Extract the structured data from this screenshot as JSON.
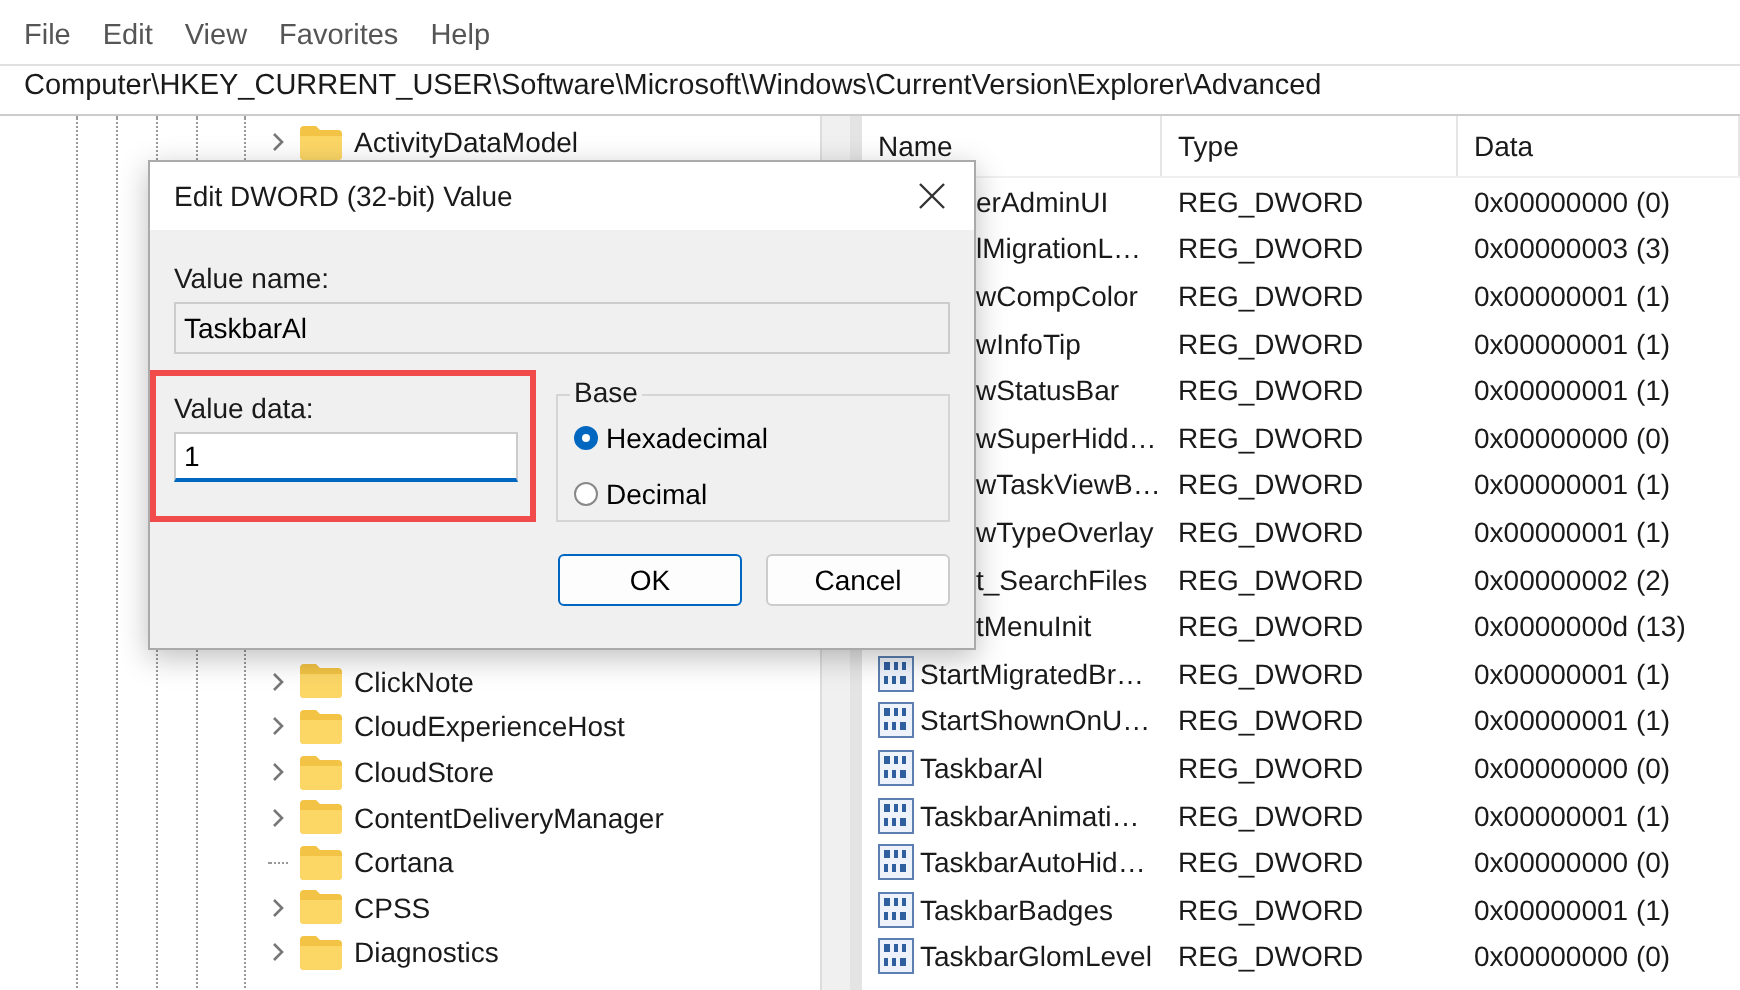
{
  "menu": [
    "File",
    "Edit",
    "View",
    "Favorites",
    "Help"
  ],
  "address": "Computer\\HKEY_CURRENT_USER\\Software\\Microsoft\\Windows\\CurrentVersion\\Explorer\\Advanced",
  "tree": [
    {
      "label": "ActivityDataModel",
      "expandable": true
    },
    {
      "label": "ClickNote",
      "expandable": true
    },
    {
      "label": "CloudExperienceHost",
      "expandable": true
    },
    {
      "label": "CloudStore",
      "expandable": true
    },
    {
      "label": "ContentDeliveryManager",
      "expandable": true
    },
    {
      "label": "Cortana",
      "expandable": false
    },
    {
      "label": "CPSS",
      "expandable": true
    },
    {
      "label": "Diagnostics",
      "expandable": true
    }
  ],
  "list": {
    "columns": [
      "Name",
      "Type",
      "Data"
    ],
    "rows": [
      {
        "name": "erAdminUI",
        "type": "REG_DWORD",
        "data": "0x00000000 (0)",
        "covered": true
      },
      {
        "name": "lMigrationL…",
        "type": "REG_DWORD",
        "data": "0x00000003 (3)",
        "covered": true
      },
      {
        "name": "wCompColor",
        "type": "REG_DWORD",
        "data": "0x00000001 (1)",
        "covered": true
      },
      {
        "name": "wInfoTip",
        "type": "REG_DWORD",
        "data": "0x00000001 (1)",
        "covered": true
      },
      {
        "name": "wStatusBar",
        "type": "REG_DWORD",
        "data": "0x00000001 (1)",
        "covered": true
      },
      {
        "name": "wSuperHidd…",
        "type": "REG_DWORD",
        "data": "0x00000000 (0)",
        "covered": true
      },
      {
        "name": "wTaskViewB…",
        "type": "REG_DWORD",
        "data": "0x00000001 (1)",
        "covered": true
      },
      {
        "name": "wTypeOverlay",
        "type": "REG_DWORD",
        "data": "0x00000001 (1)",
        "covered": true
      },
      {
        "name": "t_SearchFiles",
        "type": "REG_DWORD",
        "data": "0x00000002 (2)",
        "covered": true
      },
      {
        "name": "tMenuInit",
        "type": "REG_DWORD",
        "data": "0x0000000d (13)",
        "covered": true
      },
      {
        "name": "StartMigratedBr…",
        "type": "REG_DWORD",
        "data": "0x00000001 (1)",
        "covered": false
      },
      {
        "name": "StartShownOnU…",
        "type": "REG_DWORD",
        "data": "0x00000001 (1)",
        "covered": false
      },
      {
        "name": "TaskbarAl",
        "type": "REG_DWORD",
        "data": "0x00000000 (0)",
        "covered": false
      },
      {
        "name": "TaskbarAnimati…",
        "type": "REG_DWORD",
        "data": "0x00000001 (1)",
        "covered": false
      },
      {
        "name": "TaskbarAutoHid…",
        "type": "REG_DWORD",
        "data": "0x00000000 (0)",
        "covered": false
      },
      {
        "name": "TaskbarBadges",
        "type": "REG_DWORD",
        "data": "0x00000001 (1)",
        "covered": false
      },
      {
        "name": "TaskbarGlomLevel",
        "type": "REG_DWORD",
        "data": "0x00000000 (0)",
        "covered": false
      }
    ]
  },
  "dialog": {
    "title": "Edit DWORD (32-bit) Value",
    "value_name_label": "Value name:",
    "value_name": "TaskbarAl",
    "value_data_label": "Value data:",
    "value_data": "1",
    "base_label": "Base",
    "bases": [
      {
        "label": "Hexadecimal",
        "selected": true
      },
      {
        "label": "Decimal",
        "selected": false
      }
    ],
    "buttons": [
      {
        "label": "OK",
        "kind": "default"
      },
      {
        "label": "Cancel",
        "kind": "normal"
      }
    ]
  }
}
